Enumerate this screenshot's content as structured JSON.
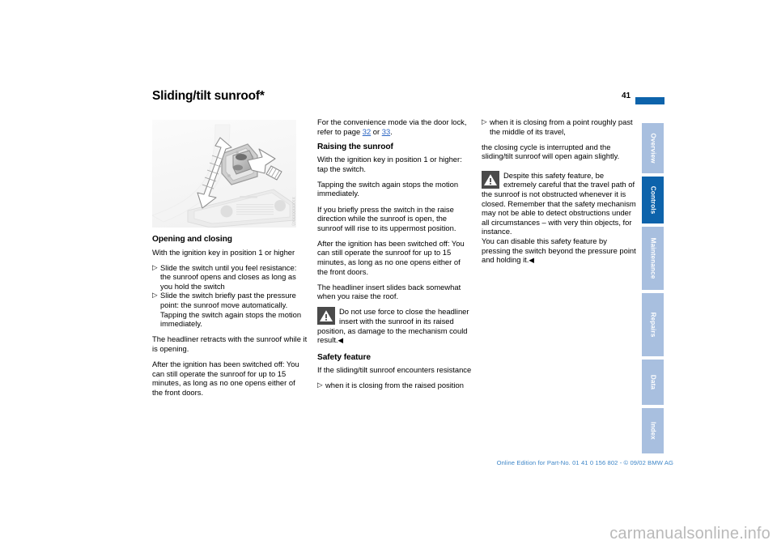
{
  "document": {
    "title": "Sliding/tilt sunroof*",
    "page_number": "41",
    "accent_color": "#0d63ab",
    "tab_inactive_color": "#a8bfdf",
    "link_color": "#2b66c4",
    "footer": "Online Edition for Part-No. 01 41 0 156 802 - © 09/02 BMW AG",
    "watermark": "carmanualsonline.info"
  },
  "figure": {
    "name": "sliding-tilt-sunroof-switch",
    "caption_id": "ÜXXXXXXXXX"
  },
  "columns": {
    "left": {
      "heading": "Opening and closing",
      "intro": "With the ignition key in position 1 or higher",
      "bullets": [
        "Slide the switch until you feel resistance: the sunroof opens and closes as long as you hold the switch",
        "Slide the switch briefly past the pressure point: the sunroof move automatically.",
        "Tapping the switch again stops the motion immediately."
      ],
      "para_retract": "The headliner retracts with the sunroof while it is opening.",
      "para_ignition_off": "After the ignition has been switched off: You can still operate the sunroof for up to 15 minutes, as long as no one opens either of the front doors."
    },
    "middle": {
      "convenience_pre": "For the convenience mode via the door lock, refer to page ",
      "convenience_link1": "32",
      "convenience_mid": " or ",
      "convenience_link2": "33",
      "convenience_post": ".",
      "heading_raising": "Raising the sunroof",
      "para_key": "With the ignition key in position 1 or higher: tap the switch.",
      "para_tap": "Tapping the switch again stops the motion immediately.",
      "para_brief": "If you briefly press the switch in the raise direction while the sunroof is open, the sunroof will rise to its uppermost position.",
      "para_ignition_off": "After the ignition has been switched off: You can still operate the sunroof for up to 15 minutes, as long as no one opens either of the front doors.",
      "para_insert": "The headliner insert slides back somewhat when you raise the roof.",
      "warning": "Do not use force to close the headliner insert with the sunroof in its raised position, as damage to the mechanism could result.",
      "heading_safety": "Safety feature",
      "para_safety_intro": "If the sliding/tilt sunroof encounters resistance",
      "bullet_raised": "when it is closing from the raised position"
    },
    "right": {
      "bullet_midtravel": "when it is closing from a point roughly past the middle of its travel,",
      "para_cycle": "the closing cycle is interrupted and the sliding/tilt sunroof will open again slightly.",
      "warning": "Despite this safety feature, be extremely careful that the travel path of the sunroof is not obstructed whenever it is closed. Remember that the safety mechanism may not be able to detect obstructions under all circumstances – with very thin objects, for instance.",
      "warning_cont": "You can disable this safety feature by pressing the switch beyond the pressure point and holding it."
    }
  },
  "tabs": [
    {
      "label": "Overview",
      "active": false
    },
    {
      "label": "Controls",
      "active": true
    },
    {
      "label": "Maintenance",
      "active": false
    },
    {
      "label": "Repairs",
      "active": false
    },
    {
      "label": "Data",
      "active": false
    },
    {
      "label": "Index",
      "active": false
    }
  ],
  "symbols": {
    "bullet_marker": "▷",
    "end_marker": "◀"
  }
}
